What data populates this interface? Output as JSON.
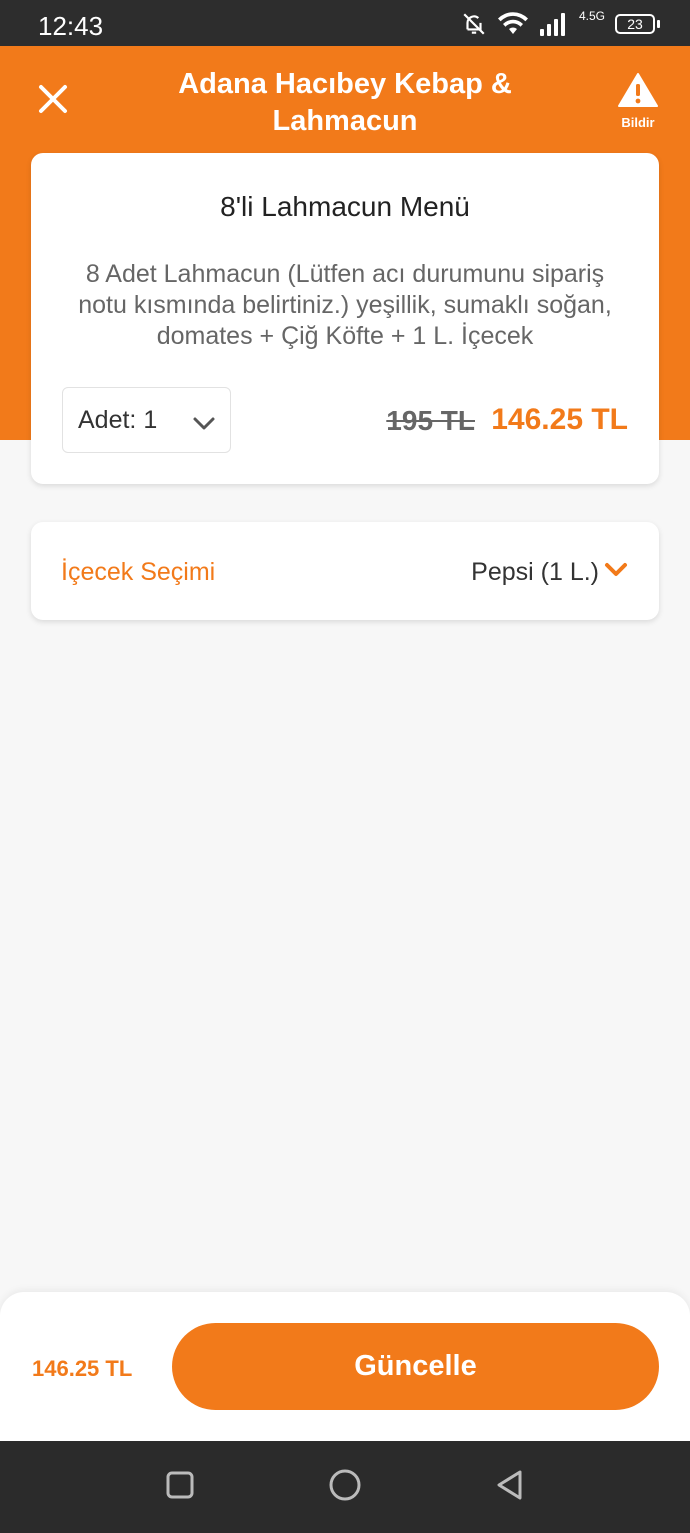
{
  "status_bar": {
    "time": "12:43",
    "network": "4.5G",
    "battery": "23",
    "icons": [
      "bell-off-icon",
      "wifi-icon",
      "signal-icon",
      "battery-icon"
    ]
  },
  "header": {
    "title": "Adana Hacıbey Kebap & Lahmacun",
    "report_label": "Bildir",
    "icons": [
      "close-icon",
      "warning-icon"
    ]
  },
  "product": {
    "title": "8'li Lahmacun Menü",
    "description": "8 Adet Lahmacun (Lütfen acı durumunu sipariş notu kısmında belirtiniz.) yeşillik, sumaklı soğan, domates + Çiğ Köfte + 1 L. İçecek",
    "quantity_label": "Adet: 1",
    "old_price": "195 TL",
    "new_price": "146.25 TL"
  },
  "options": [
    {
      "label": "İçecek Seçimi",
      "value": "Pepsi (1 L.)"
    }
  ],
  "footer": {
    "total": "146.25 TL",
    "update_label": "Güncelle"
  },
  "colors": {
    "accent": "#f27a1a",
    "background": "#f7f7f7",
    "status_bar": "#2d2d2d",
    "nav_bar": "#2b2b2b"
  },
  "nav_icons": [
    "recents-icon",
    "home-icon",
    "back-icon"
  ]
}
